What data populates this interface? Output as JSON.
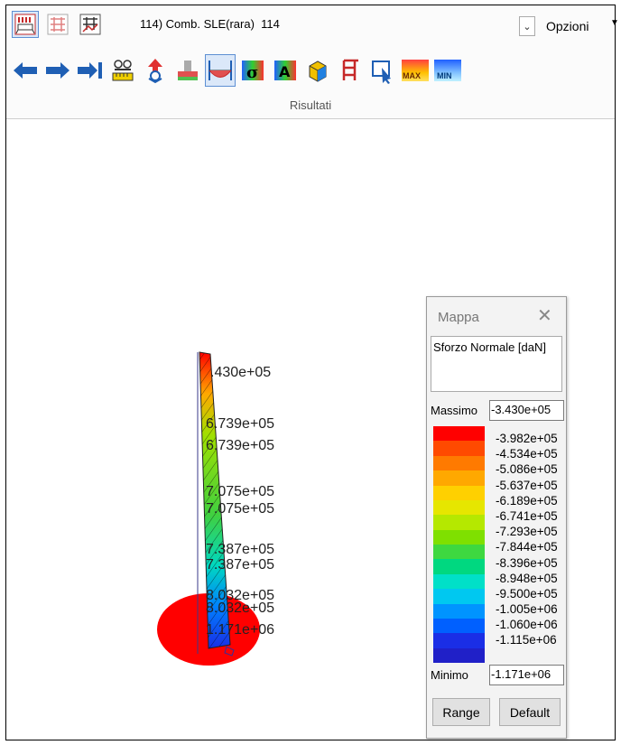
{
  "toolbar": {
    "combo_text": "114) Comb. SLE(rara)  114",
    "options_label": "Opzioni",
    "group_label": "Risultati",
    "max_label": "MAX",
    "min_label": "MIN"
  },
  "diagram": {
    "labels": [
      ".430e+05",
      "6.739e+05",
      "6.739e+05",
      "7.075e+05",
      "7.075e+05",
      "7.387e+05",
      "7.387e+05",
      "8.032e+05",
      "8.032e+05",
      "1.171e+06"
    ]
  },
  "legend": {
    "title": "Mappa",
    "quantity": "Sforzo Normale [daN]",
    "max_label": "Massimo",
    "max_value": "-3.430e+05",
    "min_label": "Minimo",
    "min_value": "-1.171e+06",
    "ticks": [
      "-3.982e+05",
      "-4.534e+05",
      "-5.086e+05",
      "-5.637e+05",
      "-6.189e+05",
      "-6.741e+05",
      "-7.293e+05",
      "-7.844e+05",
      "-8.396e+05",
      "-8.948e+05",
      "-9.500e+05",
      "-1.005e+06",
      "-1.060e+06",
      "-1.115e+06"
    ],
    "colors": [
      "#ff0000",
      "#ff4a00",
      "#ff7a00",
      "#ffa800",
      "#ffd000",
      "#e6e600",
      "#b5e800",
      "#7fe000",
      "#3ed840",
      "#00d880",
      "#00e0c8",
      "#00c8f0",
      "#0094ff",
      "#0060ff",
      "#1a2ee6",
      "#2020c8"
    ],
    "range_button": "Range",
    "default_button": "Default"
  }
}
